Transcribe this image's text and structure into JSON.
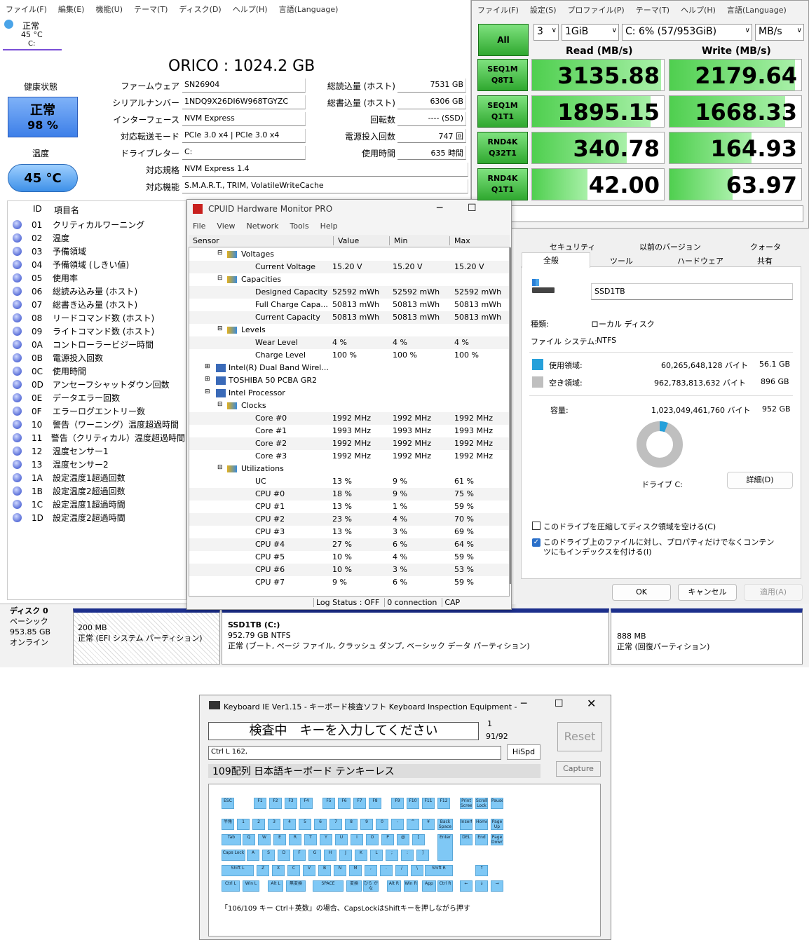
{
  "cdi": {
    "menu": [
      "ファイル(F)",
      "編集(E)",
      "機能(U)",
      "テーマ(T)",
      "ディスク(D)",
      "ヘルプ(H)",
      "言語(Language)"
    ],
    "tab": {
      "status": "正常",
      "temp": "45 °C",
      "drive": "C:"
    },
    "title": "ORICO : 1024.2 GB",
    "health_label": "健康状態",
    "health_status": "正常",
    "health_pct": "98 %",
    "temp_label": "温度",
    "temp_value": "45 °C",
    "left_labels": [
      "ファームウェア",
      "シリアルナンバー",
      "インターフェース",
      "対応転送モード",
      "ドライブレター",
      "対応規格",
      "対応機能"
    ],
    "left_values": [
      "SN26904",
      "1NDQ9X26DI6W968TGYZC",
      "NVM Express",
      "PCIe 3.0 x4 | PCIe 3.0 x4",
      "C:",
      "NVM Express 1.4",
      "S.M.A.R.T., TRIM, VolatileWriteCache"
    ],
    "right_labels": [
      "総読込量 (ホスト)",
      "総書込量 (ホスト)",
      "回転数",
      "電源投入回数",
      "使用時間"
    ],
    "right_values": [
      "7531 GB",
      "6306 GB",
      "---- (SSD)",
      "747 回",
      "635 時間"
    ],
    "col_id": "ID",
    "col_item": "項目名",
    "attrs": [
      [
        "01",
        "クリティカルワーニング"
      ],
      [
        "02",
        "温度"
      ],
      [
        "03",
        "予備領域"
      ],
      [
        "04",
        "予備領域 (しきい値)"
      ],
      [
        "05",
        "使用率"
      ],
      [
        "06",
        "総読み込み量 (ホスト)"
      ],
      [
        "07",
        "総書き込み量 (ホスト)"
      ],
      [
        "08",
        "リードコマンド数 (ホスト)"
      ],
      [
        "09",
        "ライトコマンド数 (ホスト)"
      ],
      [
        "0A",
        "コントローラービジー時間"
      ],
      [
        "0B",
        "電源投入回数"
      ],
      [
        "0C",
        "使用時間"
      ],
      [
        "0D",
        "アンセーフシャットダウン回数"
      ],
      [
        "0E",
        "データエラー回数"
      ],
      [
        "0F",
        "エラーログエントリー数"
      ],
      [
        "10",
        "警告（ワーニング）温度超過時間"
      ],
      [
        "11",
        "警告（クリティカル）温度超過時間"
      ],
      [
        "12",
        "温度センサー1"
      ],
      [
        "13",
        "温度センサー2"
      ],
      [
        "1A",
        "設定温度1超過回数"
      ],
      [
        "1B",
        "設定温度2超過回数"
      ],
      [
        "1C",
        "設定温度1超過時間"
      ],
      [
        "1D",
        "設定温度2超過時間"
      ]
    ]
  },
  "cdm": {
    "menu": [
      "ファイル(F)",
      "設定(S)",
      "プロファイル(P)",
      "テーマ(T)",
      "ヘルプ(H)",
      "言語(Language)"
    ],
    "all": "All",
    "count": "3",
    "size": "1GiB",
    "drive": "C: 6% (57/953GiB)",
    "unit": "MB/s",
    "read_h": "Read (MB/s)",
    "write_h": "Write (MB/s)",
    "rows": [
      {
        "l1": "SEQ1M",
        "l2": "Q8T1",
        "r": "3135.88",
        "w": "2179.64",
        "rf": 0.98,
        "wf": 0.95
      },
      {
        "l1": "SEQ1M",
        "l2": "Q1T1",
        "r": "1895.15",
        "w": "1668.33",
        "rf": 0.9,
        "wf": 0.88
      },
      {
        "l1": "RND4K",
        "l2": "Q32T1",
        "r": "340.78",
        "w": "164.93",
        "rf": 0.72,
        "wf": 0.62
      },
      {
        "l1": "RND4K",
        "l2": "Q1T1",
        "r": "42.00",
        "w": "63.97",
        "rf": 0.42,
        "wf": 0.48
      }
    ]
  },
  "hwm": {
    "title": "CPUID Hardware Monitor PRO",
    "menu": [
      "File",
      "View",
      "Network",
      "Tools",
      "Help"
    ],
    "cols": [
      "Sensor",
      "Value",
      "Min",
      "Max"
    ],
    "rows": [
      {
        "t": "g",
        "n": "Voltages",
        "i": 1
      },
      {
        "t": "r",
        "n": "Current Voltage",
        "v": "15.20 V",
        "mn": "15.20 V",
        "mx": "15.20 V"
      },
      {
        "t": "g",
        "n": "Capacities",
        "i": 1
      },
      {
        "t": "r",
        "n": "Designed Capacity",
        "v": "52592 mWh",
        "mn": "52592 mWh",
        "mx": "52592 mWh"
      },
      {
        "t": "r",
        "n": "Full Charge Capa...",
        "v": "50813 mWh",
        "mn": "50813 mWh",
        "mx": "50813 mWh"
      },
      {
        "t": "r",
        "n": "Current Capacity",
        "v": "50813 mWh",
        "mn": "50813 mWh",
        "mx": "50813 mWh"
      },
      {
        "t": "g",
        "n": "Levels",
        "i": 1
      },
      {
        "t": "r",
        "n": "Wear Level",
        "v": "4 %",
        "mn": "4 %",
        "mx": "4 %"
      },
      {
        "t": "r",
        "n": "Charge Level",
        "v": "100 %",
        "mn": "100 %",
        "mx": "100 %"
      },
      {
        "t": "d",
        "n": "Intel(R) Dual Band Wirel..."
      },
      {
        "t": "d",
        "n": "TOSHIBA 50 PCBA GR2"
      },
      {
        "t": "d",
        "n": "Intel Processor"
      },
      {
        "t": "g",
        "n": "Clocks",
        "i": 1
      },
      {
        "t": "r",
        "n": "Core #0",
        "v": "1992 MHz",
        "mn": "1992 MHz",
        "mx": "1992 MHz"
      },
      {
        "t": "r",
        "n": "Core #1",
        "v": "1993 MHz",
        "mn": "1993 MHz",
        "mx": "1993 MHz"
      },
      {
        "t": "r",
        "n": "Core #2",
        "v": "1992 MHz",
        "mn": "1992 MHz",
        "mx": "1992 MHz"
      },
      {
        "t": "r",
        "n": "Core #3",
        "v": "1992 MHz",
        "mn": "1992 MHz",
        "mx": "1992 MHz"
      },
      {
        "t": "g",
        "n": "Utilizations",
        "i": 1
      },
      {
        "t": "r",
        "n": "UC",
        "v": "13 %",
        "mn": "9 %",
        "mx": "61 %"
      },
      {
        "t": "r",
        "n": "CPU #0",
        "v": "18 %",
        "mn": "9 %",
        "mx": "75 %"
      },
      {
        "t": "r",
        "n": "CPU #1",
        "v": "13 %",
        "mn": "1 %",
        "mx": "59 %"
      },
      {
        "t": "r",
        "n": "CPU #2",
        "v": "23 %",
        "mn": "4 %",
        "mx": "70 %"
      },
      {
        "t": "r",
        "n": "CPU #3",
        "v": "13 %",
        "mn": "3 %",
        "mx": "69 %"
      },
      {
        "t": "r",
        "n": "CPU #4",
        "v": "27 %",
        "mn": "6 %",
        "mx": "64 %"
      },
      {
        "t": "r",
        "n": "CPU #5",
        "v": "10 %",
        "mn": "4 %",
        "mx": "59 %"
      },
      {
        "t": "r",
        "n": "CPU #6",
        "v": "10 %",
        "mn": "3 %",
        "mx": "53 %"
      },
      {
        "t": "r",
        "n": "CPU #7",
        "v": "9 %",
        "mn": "6 %",
        "mx": "59 %"
      }
    ],
    "status": [
      "Log Status : OFF",
      "0 connection",
      "CAP"
    ]
  },
  "props": {
    "tabs_top": [
      "セキュリティ",
      "以前のバージョン",
      "クォータ"
    ],
    "tabs_bot": [
      "全般",
      "ツール",
      "ハードウェア",
      "共有"
    ],
    "name": "SSD1TB",
    "type_l": "種類:",
    "type_v": "ローカル ディスク",
    "fs_l": "ファイル システム:",
    "fs_v": "NTFS",
    "used_l": "使用領域:",
    "used_b": "60,265,648,128 バイト",
    "used_g": "56.1 GB",
    "free_l": "空き領域:",
    "free_b": "962,783,813,632 バイト",
    "free_g": "896 GB",
    "cap_l": "容量:",
    "cap_b": "1,023,049,461,760 バイト",
    "cap_g": "952 GB",
    "used_fraction": 0.059,
    "drive": "ドライブ C:",
    "detail": "詳細(D)",
    "compress": "このドライブを圧縮してディスク領域を空ける(C)",
    "index": "このドライブ上のファイルに対し、プロパティだけでなくコンテンツにもインデックスを付ける(I)",
    "ok": "OK",
    "cancel": "キャンセル",
    "apply": "適用(A)"
  },
  "dm": {
    "disk": "ディスク 0",
    "kind": "ベーシック",
    "size": "953.85 GB",
    "state": "オンライン",
    "p1a": "200 MB",
    "p1b": "正常 (EFI システム パーティション)",
    "p2t": "SSD1TB  (C:)",
    "p2a": "952.79 GB NTFS",
    "p2b": "正常 (ブート, ページ ファイル, クラッシュ ダンプ, ベーシック データ パーティション)",
    "p3a": "888 MB",
    "p3b": "正常 (回復パーティション)"
  },
  "kb": {
    "title": "Keyboard IE Ver1.15 - キーボード検査ソフト Keyboard Inspection Equipment -",
    "banner": "検査中　キーを入力してください",
    "count1": "1",
    "count2": "91/92",
    "reset": "Reset",
    "hispd": "HiSpd",
    "capture": "Capture",
    "input": "Ctrl L 162,",
    "layout": "109配列 日本語キーボード テンキーレス",
    "note": "「106/109 キー Ctrl＋英数」の場合、CapsLockはShiftキーを押しながら押す",
    "frow": [
      "ESC",
      "F1",
      "F2",
      "F3",
      "F4",
      "F5",
      "F6",
      "F7",
      "F8",
      "F9",
      "F10",
      "F11",
      "F12"
    ],
    "nav1": [
      "Print Screen",
      "Scroll Lock",
      "Pause"
    ],
    "r1": [
      "半角",
      "1",
      "2",
      "3",
      "4",
      "5",
      "6",
      "7",
      "8",
      "9",
      "0",
      "-",
      "^",
      "¥",
      "Back Space"
    ],
    "nav2": [
      "Insert",
      "Home",
      "Page Up"
    ],
    "r2": [
      "Tab",
      "Q",
      "W",
      "E",
      "R",
      "T",
      "Y",
      "U",
      "I",
      "O",
      "P",
      "@",
      "[",
      "Enter"
    ],
    "nav3": [
      "DEL",
      "End",
      "Page Down"
    ],
    "r3": [
      "Caps Lock",
      "A",
      "S",
      "D",
      "F",
      "G",
      "H",
      "J",
      "K",
      "L",
      ";",
      ":",
      "]"
    ],
    "r4": [
      "Shift L",
      "Z",
      "X",
      "C",
      "V",
      "B",
      "N",
      "M",
      ",",
      ".",
      "/",
      "\\",
      "Shift R"
    ],
    "r5": [
      "Ctrl L",
      "Win L",
      "Alt L",
      "無変換",
      "SPACE",
      "変換",
      "ひら がな",
      "Alt R",
      "Win R",
      "App",
      "Ctrl R"
    ],
    "arrows": [
      "↑",
      "←",
      "↓",
      "→"
    ]
  }
}
